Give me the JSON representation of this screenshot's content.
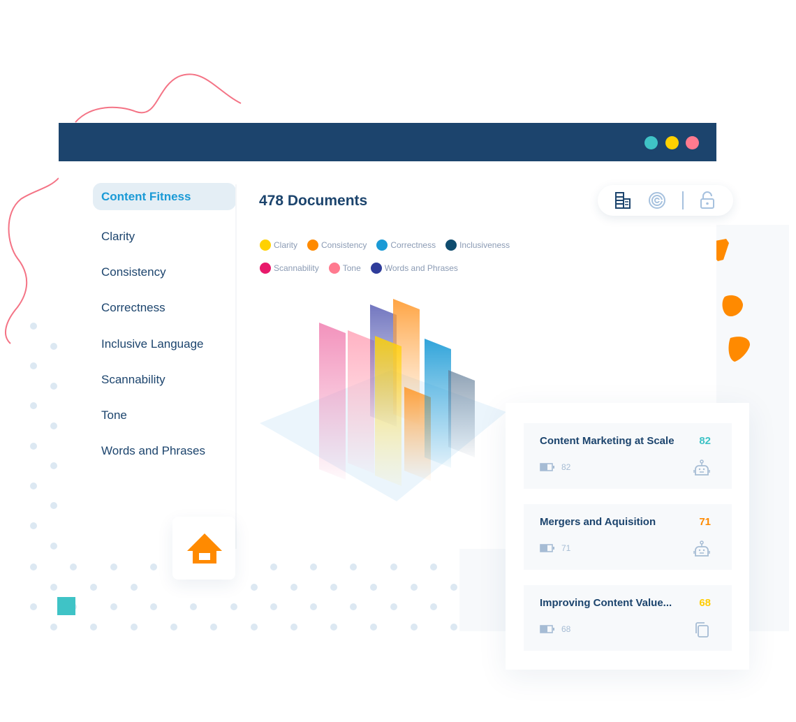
{
  "colors": {
    "navy": "#1c446d",
    "accent_blue": "#1a9ad6",
    "teal": "#3fc3c6",
    "yellow": "#ffcc00",
    "pink": "#ff7a8f",
    "orange": "#ff8a00"
  },
  "window": {
    "controls": [
      {
        "name": "teal-window-dot",
        "color": "#3fc3c6"
      },
      {
        "name": "yellow-window-dot",
        "color": "#ffd100"
      },
      {
        "name": "pink-window-dot",
        "color": "#ff7a8f"
      }
    ]
  },
  "sidebar": {
    "items": [
      {
        "label": "Content Fitness",
        "active": true
      },
      {
        "label": "Clarity",
        "active": false
      },
      {
        "label": "Consistency",
        "active": false
      },
      {
        "label": "Correctness",
        "active": false
      },
      {
        "label": "Inclusive Language",
        "active": false
      },
      {
        "label": "Scannability",
        "active": false
      },
      {
        "label": "Tone",
        "active": false
      },
      {
        "label": "Words and Phrases",
        "active": false
      }
    ]
  },
  "main": {
    "title": "478 Documents"
  },
  "legend": {
    "rows": [
      [
        {
          "label": "Clarity",
          "color": "#ffd100"
        },
        {
          "label": "Consistency",
          "color": "#ff8a00"
        },
        {
          "label": "Correctness",
          "color": "#1a9ad6"
        },
        {
          "label": "Inclusiveness",
          "color": "#0f4c6e"
        }
      ],
      [
        {
          "label": "Scannability",
          "color": "#e8196b"
        },
        {
          "label": "Tone",
          "color": "#ff7a8f"
        },
        {
          "label": "Words and Phrases",
          "color": "#2f3c9a"
        }
      ]
    ]
  },
  "toolbar": {
    "icons": [
      "table-view-icon",
      "radar-chart-icon",
      "unlock-icon"
    ]
  },
  "documents": [
    {
      "title": "Content Marketing at Scale",
      "score": "82",
      "score_color": "#3fc3c6",
      "meta": "82",
      "action_icon": "robot-icon"
    },
    {
      "title": "Mergers and Aquisition",
      "score": "71",
      "score_color": "#ff8a00",
      "meta": "71",
      "action_icon": "robot-icon"
    },
    {
      "title": "Improving Content Value...",
      "score": "68",
      "score_color": "#ffcc00",
      "meta": "68",
      "action_icon": "copy-icon"
    }
  ],
  "home": {
    "icon": "home-icon",
    "color": "#ff8a00"
  }
}
